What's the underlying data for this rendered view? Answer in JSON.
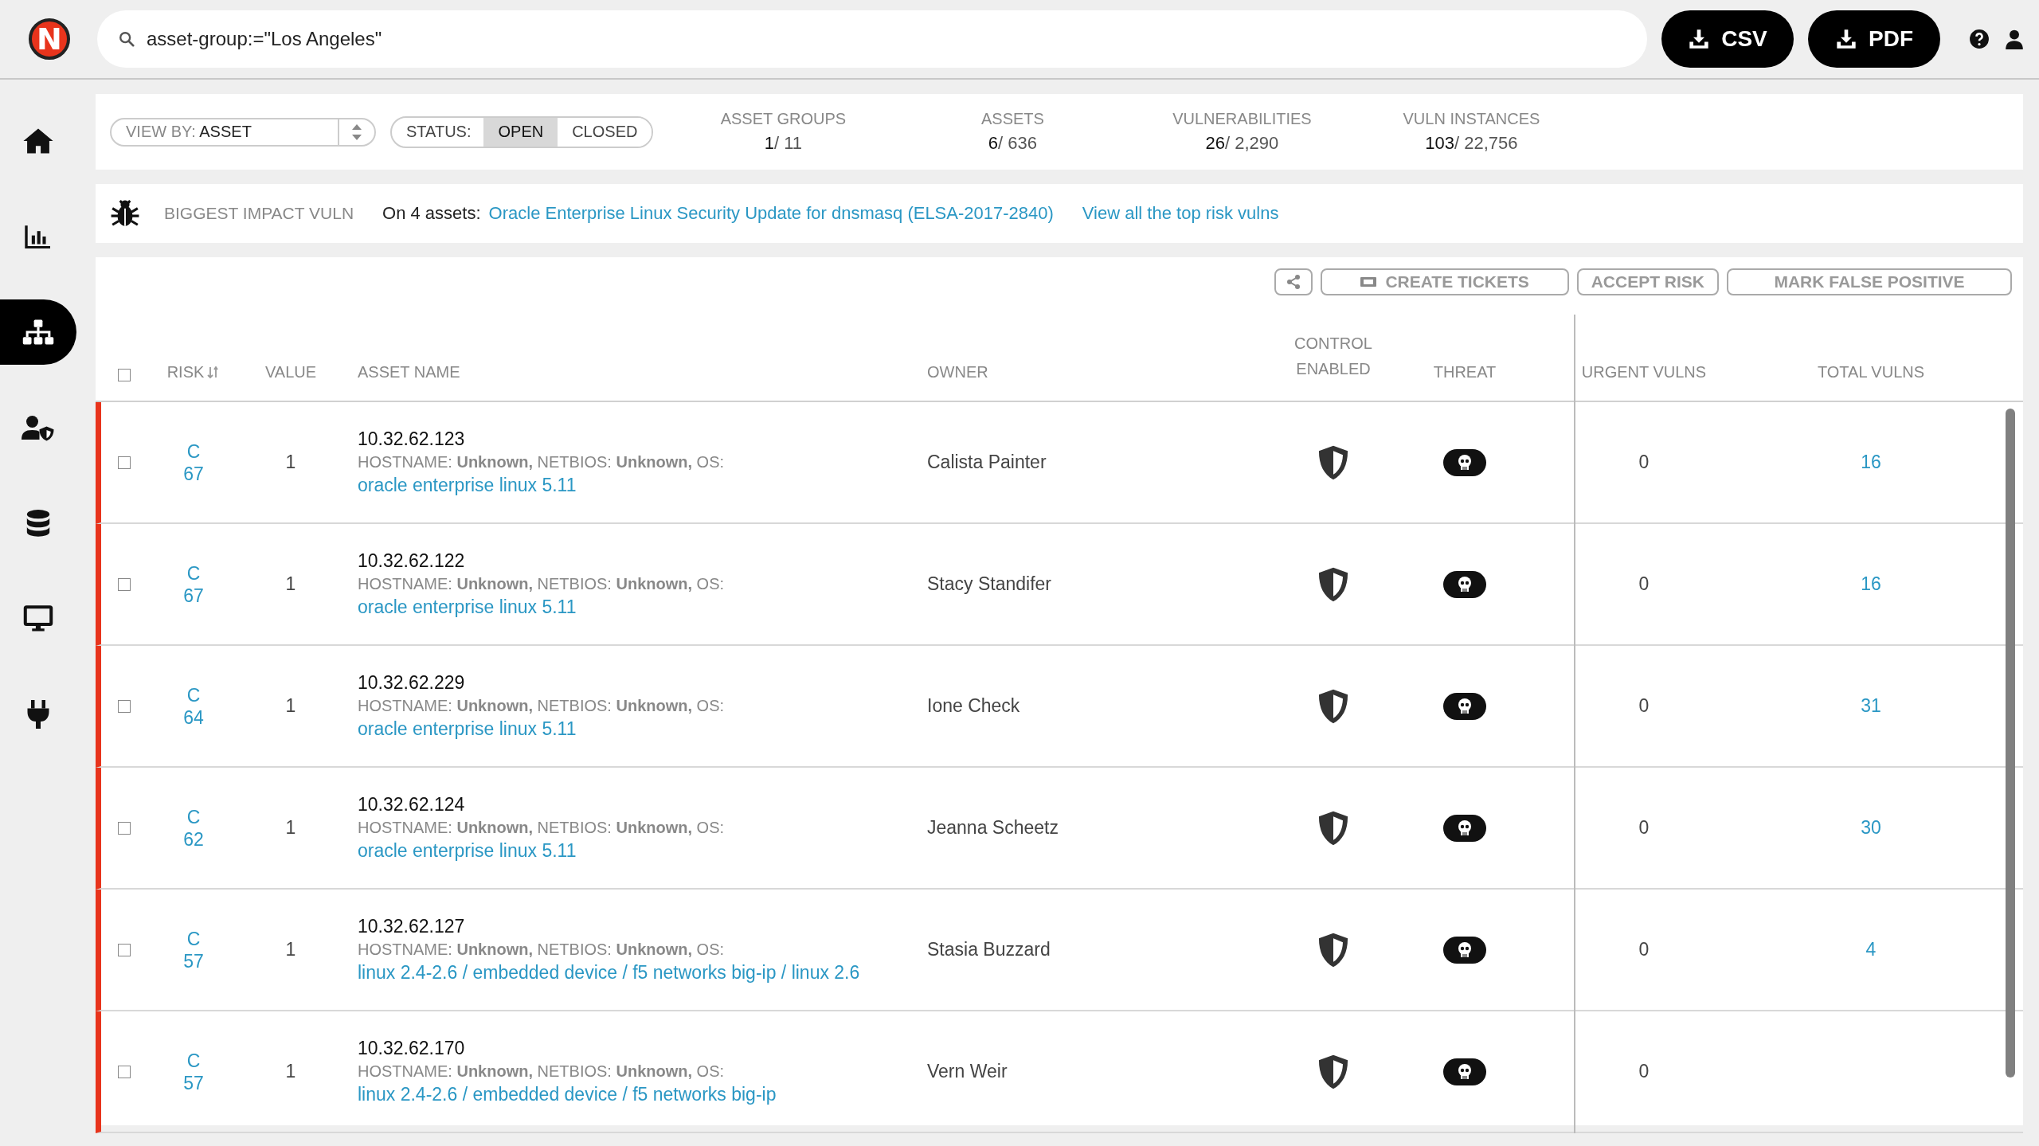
{
  "logo": {
    "letter": "N"
  },
  "search": {
    "query": "asset-group:=\"Los Angeles\""
  },
  "export_buttons": [
    {
      "label": "CSV"
    },
    {
      "label": "PDF"
    }
  ],
  "sidebar": {
    "items": [
      {
        "kind": "home",
        "selected": false
      },
      {
        "kind": "chart",
        "selected": false
      },
      {
        "kind": "network",
        "selected": true
      },
      {
        "kind": "user-shield",
        "selected": false
      },
      {
        "kind": "database",
        "selected": false
      },
      {
        "kind": "monitor",
        "selected": false
      },
      {
        "kind": "plug",
        "selected": false
      }
    ]
  },
  "filters": {
    "view_by": {
      "label": "VIEW BY:",
      "value": "ASSET"
    },
    "status": {
      "label": "STATUS:",
      "options": [
        {
          "label": "OPEN",
          "selected": true
        },
        {
          "label": "CLOSED",
          "selected": false
        }
      ]
    }
  },
  "stats": [
    {
      "label": "ASSET GROUPS",
      "count": "1",
      "total": "/ 11"
    },
    {
      "label": "ASSETS",
      "count": "6",
      "total": "/ 636"
    },
    {
      "label": "VULNERABILITIES",
      "count": "26",
      "total": "/ 2,290"
    },
    {
      "label": "VULN INSTANCES",
      "count": "103",
      "total": "/ 22,756"
    }
  ],
  "impact": {
    "label": "BIGGEST IMPACT VULN",
    "prefix": "On 4 assets:",
    "vuln_link": "Oracle Enterprise Linux Security Update for dnsmasq (ELSA-2017-2840)",
    "view_all_link": "View all the top risk vulns"
  },
  "actions": [
    {
      "kind": "share"
    },
    {
      "kind": "ticket",
      "label": "CREATE TICKETS"
    },
    {
      "kind": "text",
      "label": "ACCEPT RISK"
    },
    {
      "kind": "text",
      "label": "MARK FALSE POSITIVE"
    }
  ],
  "table": {
    "select_all_checked": false,
    "columns": [
      {
        "kind": "risk",
        "label": "RISK"
      },
      {
        "kind": "value",
        "label": "VALUE"
      },
      {
        "kind": "name",
        "label": "ASSET NAME"
      },
      {
        "kind": "owner",
        "label": "OWNER"
      },
      {
        "kind": "control",
        "label": "CONTROL ENABLED"
      },
      {
        "kind": "threat",
        "label": "THREAT"
      },
      {
        "kind": "urgent",
        "label": "URGENT VULNS"
      },
      {
        "kind": "total",
        "label": "TOTAL VULNS"
      }
    ],
    "rows": [
      {
        "checked": false,
        "grade": "C",
        "score": "67",
        "value": "1",
        "ip": "10.32.62.123",
        "details": "HOSTNAME: **Unknown,** NETBIOS: **Unknown,** OS:",
        "os": "oracle enterprise linux 5.11",
        "owner": "Calista Painter",
        "urgent": "0",
        "total": "16"
      },
      {
        "checked": false,
        "grade": "C",
        "score": "67",
        "value": "1",
        "ip": "10.32.62.122",
        "details": "HOSTNAME: **Unknown,** NETBIOS: **Unknown,** OS:",
        "os": "oracle enterprise linux 5.11",
        "owner": "Stacy Standifer",
        "urgent": "0",
        "total": "16"
      },
      {
        "checked": false,
        "grade": "C",
        "score": "64",
        "value": "1",
        "ip": "10.32.62.229",
        "details": "HOSTNAME: **Unknown,** NETBIOS: **Unknown,** OS:",
        "os": "oracle enterprise linux 5.11",
        "owner": "Ione Check",
        "urgent": "0",
        "total": "31"
      },
      {
        "checked": false,
        "grade": "C",
        "score": "62",
        "value": "1",
        "ip": "10.32.62.124",
        "details": "HOSTNAME: **Unknown,** NETBIOS: **Unknown,** OS:",
        "os": "oracle enterprise linux 5.11",
        "owner": "Jeanna Scheetz",
        "urgent": "0",
        "total": "30"
      },
      {
        "checked": false,
        "grade": "C",
        "score": "57",
        "value": "1",
        "ip": "10.32.62.127",
        "details": "HOSTNAME: **Unknown,** NETBIOS: **Unknown,** OS:",
        "os": "linux 2.4-2.6 / embedded device / f5 networks big-ip / linux 2.6",
        "owner": "Stasia Buzzard",
        "urgent": "0",
        "total": "4"
      },
      {
        "checked": false,
        "grade": "C",
        "score": "57",
        "value": "1",
        "ip": "10.32.62.170",
        "details": "HOSTNAME: **Unknown,** NETBIOS: **Unknown,** OS:",
        "os": "linux 2.4-2.6 / embedded device / f5 networks big-ip",
        "owner": "Vern Weir",
        "urgent": "0"
      }
    ]
  }
}
